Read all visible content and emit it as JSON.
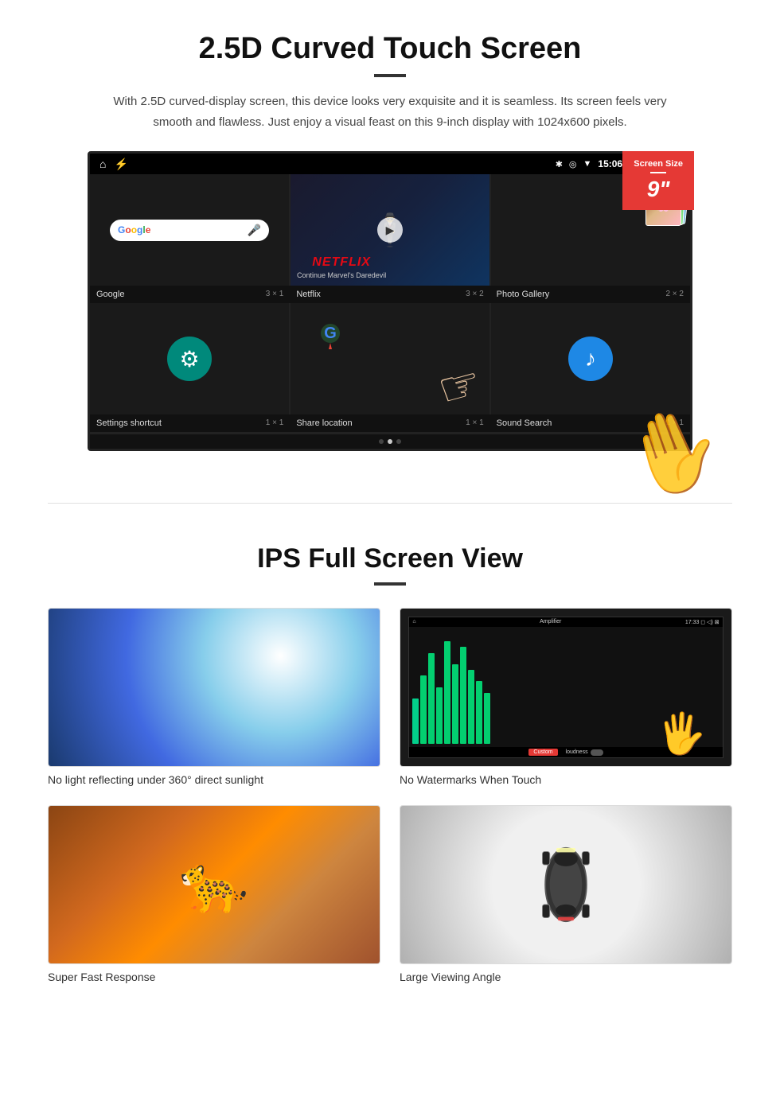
{
  "section1": {
    "title": "2.5D Curved Touch Screen",
    "description": "With 2.5D curved-display screen, this device looks very exquisite and it is seamless. Its screen feels very smooth and flawless. Just enjoy a visual feast on this 9-inch display with 1024x600 pixels.",
    "badge": {
      "label": "Screen Size",
      "size": "9\""
    },
    "statusBar": {
      "time": "15:06"
    },
    "appRow1": [
      {
        "name": "Google",
        "size": "3 × 1"
      },
      {
        "name": "Netflix",
        "size": "3 × 2"
      },
      {
        "name": "Photo Gallery",
        "size": "2 × 2"
      }
    ],
    "appRow2": [
      {
        "name": "Settings shortcut",
        "size": "1 × 1"
      },
      {
        "name": "Share location",
        "size": "1 × 1"
      },
      {
        "name": "Sound Search",
        "size": "1 × 1"
      }
    ],
    "netflix": {
      "logo": "NETFLIX",
      "subtitle": "Continue Marvel's Daredevil"
    }
  },
  "section2": {
    "title": "IPS Full Screen View",
    "features": [
      {
        "id": "sunlight",
        "label": "No light reflecting under 360° direct sunlight"
      },
      {
        "id": "amplifier",
        "label": "No Watermarks When Touch"
      },
      {
        "id": "cheetah",
        "label": "Super Fast Response"
      },
      {
        "id": "car",
        "label": "Large Viewing Angle"
      }
    ]
  }
}
